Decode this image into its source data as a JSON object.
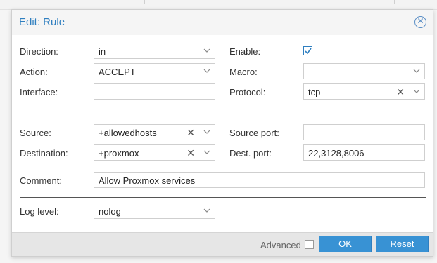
{
  "dialog": {
    "title": "Edit: Rule",
    "close_icon": "close-circle-icon"
  },
  "fields": {
    "direction": {
      "label": "Direction:",
      "value": "in"
    },
    "action": {
      "label": "Action:",
      "value": "ACCEPT"
    },
    "interface": {
      "label": "Interface:",
      "value": ""
    },
    "enable": {
      "label": "Enable:",
      "checked": true
    },
    "macro": {
      "label": "Macro:",
      "value": ""
    },
    "protocol": {
      "label": "Protocol:",
      "value": "tcp"
    },
    "source": {
      "label": "Source:",
      "value": "+allowedhosts"
    },
    "destination": {
      "label": "Destination:",
      "value": "+proxmox"
    },
    "source_port": {
      "label": "Source port:",
      "value": ""
    },
    "dest_port": {
      "label": "Dest. port:",
      "value": "22,3128,8006"
    },
    "comment": {
      "label": "Comment:",
      "value": "Allow Proxmox services"
    },
    "log_level": {
      "label": "Log level:",
      "value": "nolog"
    }
  },
  "footer": {
    "advanced_label": "Advanced",
    "advanced_checked": false,
    "ok_label": "OK",
    "reset_label": "Reset"
  },
  "colors": {
    "accent": "#3892d4",
    "title": "#2f7fc0"
  }
}
